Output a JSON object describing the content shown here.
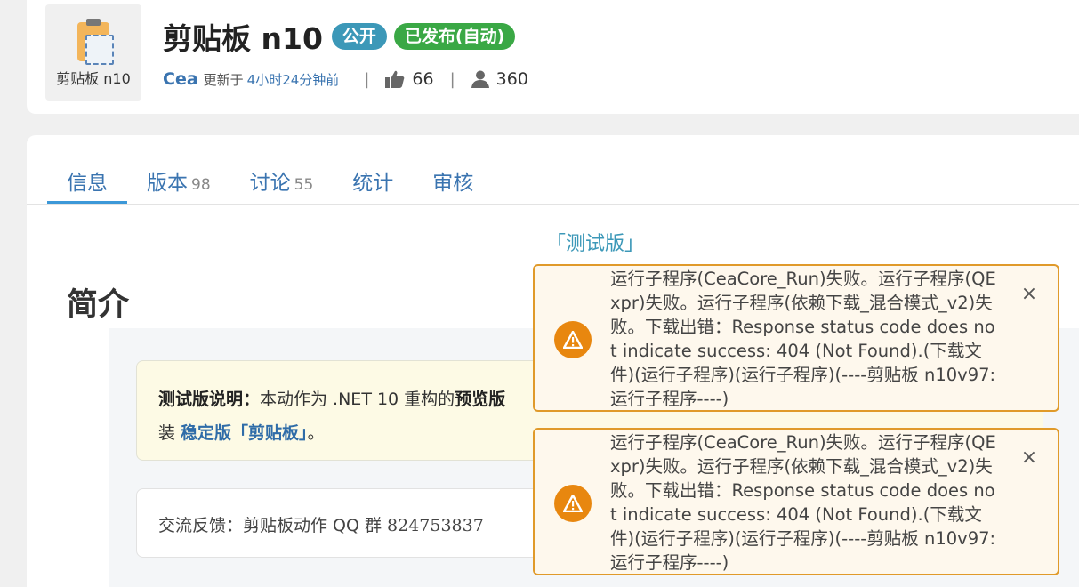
{
  "app": {
    "icon_label": "剪贴板 n10",
    "title": "剪贴板 n10",
    "badges": {
      "public": "公开",
      "published": "已发布(自动)"
    },
    "author": "Cea",
    "updated_prefix": "更新于",
    "updated_time": "4小时24分钟前",
    "likes": "66",
    "users": "360",
    "separator": "|"
  },
  "tabs": [
    {
      "label": "信息",
      "count": ""
    },
    {
      "label": "版本",
      "count": "98"
    },
    {
      "label": "讨论",
      "count": "55"
    },
    {
      "label": "统计",
      "count": ""
    },
    {
      "label": "审核",
      "count": ""
    }
  ],
  "content": {
    "beta_tag": "「测试版」",
    "section_title": "简介",
    "beta_note": {
      "label": "测试版说明：",
      "text1": "本动作为 .NET 10 重构的",
      "bold": "预览版",
      "line2_prefix": "装 ",
      "link": "稳定版「剪贴板」",
      "line2_suffix": "。"
    },
    "feedback": {
      "prefix": "交流反馈：剪贴板动作 QQ 群",
      "qq": "824753837"
    }
  },
  "toasts": [
    {
      "message": "运行子程序(CeaCore_Run)失败。运行子程序(QExpr)失败。运行子程序(依赖下载_混合模式_v2)失败。下载出错：Response status code does not indicate success: 404 (Not Found).(下载文件)(运行子程序)(运行子程序)(----剪贴板 n10v97:运行子程序----)",
      "close": "×"
    },
    {
      "message": "运行子程序(CeaCore_Run)失败。运行子程序(QExpr)失败。运行子程序(依赖下载_混合模式_v2)失败。下载出错：Response status code does not indicate success: 404 (Not Found).(下载文件)(运行子程序)(运行子程序)(----剪贴板 n10v97:运行子程序----)",
      "close": "×"
    }
  ],
  "colors": {
    "accent_blue": "#3a74b0",
    "badge_public": "#3c98b8",
    "badge_published": "#3aa845",
    "warning": "#e8870f"
  },
  "icons": [
    "clipboard-icon",
    "thumbs-up-icon",
    "user-icon",
    "warning-icon",
    "close-icon"
  ]
}
